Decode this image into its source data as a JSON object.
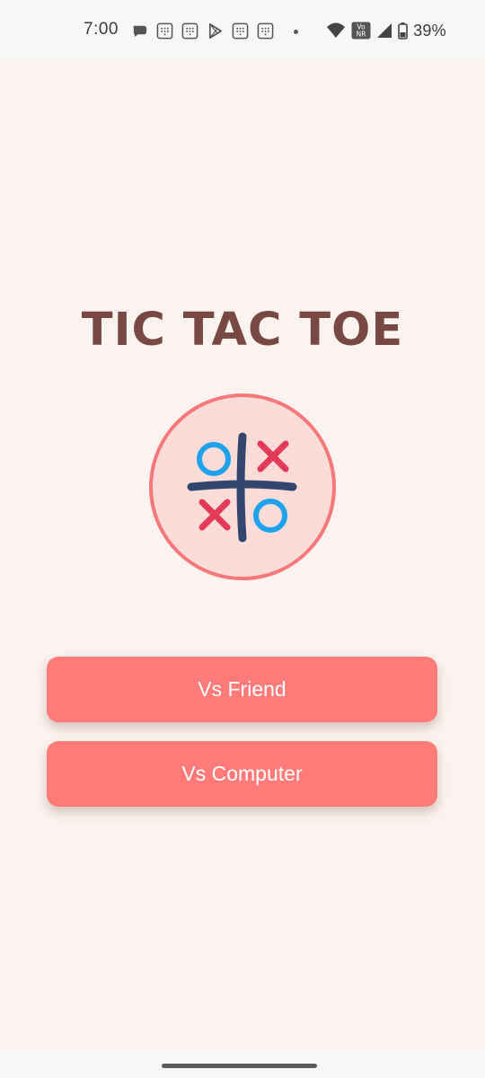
{
  "status_bar": {
    "time": "7:00",
    "notification_icons": [
      "chat-bubble-icon",
      "dialpad-icon",
      "dialpad-icon",
      "play-store-icon",
      "dialpad-icon",
      "dialpad-icon",
      "more-dot-icon"
    ],
    "network_badge": "Vo NR",
    "battery_percent": "39%"
  },
  "app": {
    "title": "TIC TAC TOE",
    "buttons": {
      "vs_friend": "Vs Friend",
      "vs_computer": "Vs Computer"
    }
  },
  "colors": {
    "background": "#fbf3ef",
    "title": "#784842",
    "button": "#ff7b79",
    "logo_ring": "#f6787a",
    "logo_fill": "#fbdcd9",
    "grid": "#33466e",
    "x_mark": "#e43a58",
    "o_mark": "#1fa2eb"
  }
}
